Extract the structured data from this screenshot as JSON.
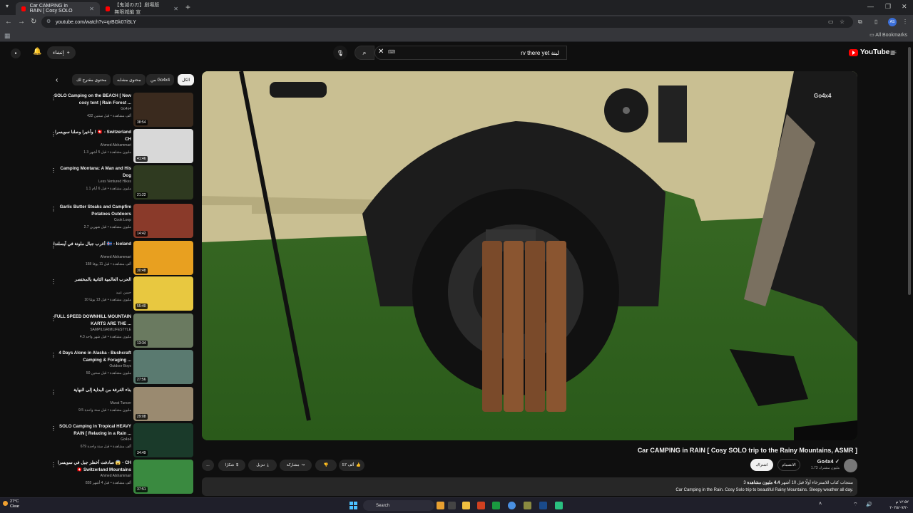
{
  "browser": {
    "tabs": [
      {
        "title": "Car CAMPING in RAIN [ Cosy SOLO",
        "active": true
      },
      {
        "title": "【鬼滅の刃】劇場版 無限城編 宣",
        "active": false
      }
    ],
    "new_tab": "+",
    "url": "youtube.com/watch?v=qrBGk07i5LY",
    "profile_initials": "AS",
    "all_bookmarks": "All Bookmarks"
  },
  "youtube": {
    "logo_text": "YouTube",
    "region": "AE",
    "search_query": "rv there yet لبنة",
    "create_label": "إنشاء",
    "chips": [
      "الكل",
      "من Go4x4",
      "محتوى مشابه",
      "محتوى مقترح لك"
    ],
    "recommendations": [
      {
        "title": "SOLO Camping on the BEACH [ New cosy tent | Rain Forest ...",
        "channel": "Go4x4",
        "meta": "432 ألف مشاهدة • قبل سنتين",
        "duration": "38:54",
        "thumb_color": "#3a2a1e"
      },
      {
        "title": "وأخيرا وصلنا سويسرا ! 🇨🇭 - Switzerland CH",
        "channel": "Ahmed Alshammari",
        "meta": "1.3 مليون مشاهدة • قبل 5 أشهر",
        "duration": "41:46",
        "thumb_color": "#d8d8d8"
      },
      {
        "title": "Camping Montana: A Man and His Dog",
        "channel": "Less Ventured Hikes",
        "meta": "1.1 مليون مشاهدة • قبل 6 أيام",
        "duration": "21:22",
        "thumb_color": "#2f3a20"
      },
      {
        "title": "Garlic Butter Steaks and Campfire Potatoes Outdoors",
        "channel": "Cook Loop",
        "meta": "2.7 مليون مشاهدة • قبل شهرين",
        "duration": "14:42",
        "thumb_color": "#8a3a2a"
      },
      {
        "title": "أغرب جبال ملونة في آيسلندا 🇮🇸 - Iceland",
        "channel": "Ahmed Alshammari",
        "meta": "158 ألف مشاهدة • قبل 11 يومًا",
        "duration": "30:48",
        "thumb_color": "#e8a020"
      },
      {
        "title": "الحرب العالمية الثانية بالمختصر",
        "channel": "حسن عبيد",
        "meta": "10 مليون مشاهدة • قبل 13 يومًا",
        "duration": "55:40",
        "thumb_color": "#e8c840"
      },
      {
        "title": "FULL SPEED DOWNHILL MOUNTAIN KARTS ARE THE ...",
        "channel": "SAMPILGRIMLIFESTYLE",
        "meta": "4.3 مليون مشاهدة • قبل شهر واحد",
        "duration": "13:34",
        "thumb_color": "#6a7a60"
      },
      {
        "title": "4 Days Alone in Alaska - Bushcraft Camping & Foraging ...",
        "channel": "Outdoor Boys",
        "meta": "50 مليون مشاهدة • قبل سنتين",
        "duration": "27:56",
        "thumb_color": "#5a7a70"
      },
      {
        "title": "بناء الغرفة من البداية إلى النهاية",
        "channel": "Murat Tuncer",
        "meta": "9.5 مليون مشاهدة • قبل سنة واحدة",
        "duration": "29:08",
        "thumb_color": "#9a8a70"
      },
      {
        "title": "SOLO Camping in Tropical HEAVY RAIN [ Relaxing in a Rain ...",
        "channel": "Go4x4",
        "meta": "679 ألف مشاهدة • قبل سنة واحدة",
        "duration": "34:49",
        "thumb_color": "#1a3a2a"
      },
      {
        "title": "صادفت أخطر جبل في سويسرا 😱 - CH 🇨🇭 Switzerland Mountains",
        "channel": "Ahmed Alshammari",
        "meta": "828 ألف مشاهدة • قبل 4 أشهر",
        "duration": "37:51",
        "thumb_color": "#3a8a40"
      }
    ],
    "video": {
      "title": "Car CAMPING in RAIN [ Cosy SOLO trip to the Rainy Mountains, ASMR ]",
      "channel": "Go4x4",
      "subscribers": "1.73 مليون مشترك",
      "subscribe_label": "اشتراك",
      "join_label": "الانضمام",
      "likes": "57 ألف",
      "share_label": "مشاركة",
      "download_label": "تنزيل",
      "thanks_label": "شكرًا",
      "more_label": "...",
      "views": "4.4 مليون مشاهدة",
      "age": "قبل 10 أشهر",
      "tags_hint": "كتاب للاسترخاء أولًا",
      "tags_count": "3 منتجات",
      "description": "Car Camping in the Rain. Cosy Solo trip to beautiful Rainy Mountains. Sleepy weather all day.",
      "watermark": "Go4x4"
    }
  },
  "taskbar": {
    "temperature": "27°C",
    "condition": "Clear",
    "search_placeholder": "Search",
    "time": "١٢:٥٢ م",
    "date": "٢٠٢٥/٠٧/٢٠"
  }
}
